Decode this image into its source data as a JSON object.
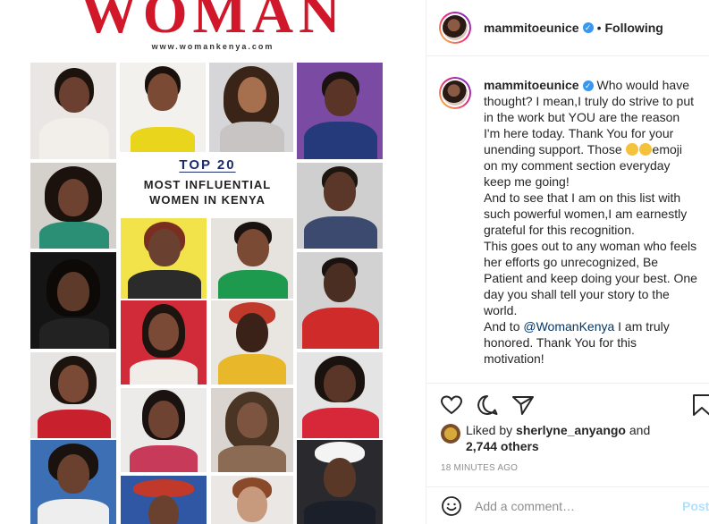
{
  "magazine": {
    "title": "WOMAN",
    "url": "www.womankenya.com",
    "headline": "TOP 20",
    "subheadline_1": "MOST INFLUENTIAL",
    "subheadline_2": "WOMEN IN KENYA"
  },
  "header": {
    "username": "mammitoeunice",
    "dot": "•",
    "follow_status": "Following"
  },
  "caption": {
    "username": "mammitoeunice",
    "p1": "Who would have thought? I mean,I truly do strive to put in the work but YOU are the reason I'm here today. Thank You for your unending support. Those",
    "p1b": "emoji on my comment section everyday keep me going!",
    "p2": "And to see that I am on this list with such powerful women,I am earnestly grateful for this recognition.",
    "p3": "This goes out to any woman who feels her efforts go unrecognized, Be Patient and keep doing your best. One day you shall tell your story to the world.",
    "p4_pre": "And to",
    "mention": "@WomanKenya",
    "p4_post": "I am truly honored. Thank You for this motivation!"
  },
  "likes": {
    "prefix": "Liked by",
    "user": "sherlyne_anyango",
    "and": "and",
    "others": "2,744 others"
  },
  "timestamp": "18 MINUTES AGO",
  "comment": {
    "placeholder": "Add a comment…",
    "post_label": "Post"
  },
  "colors": {
    "brand_red": "#d0182a",
    "link": "#00376b",
    "verified": "#3897f0",
    "post_disabled": "#b2dffc"
  }
}
